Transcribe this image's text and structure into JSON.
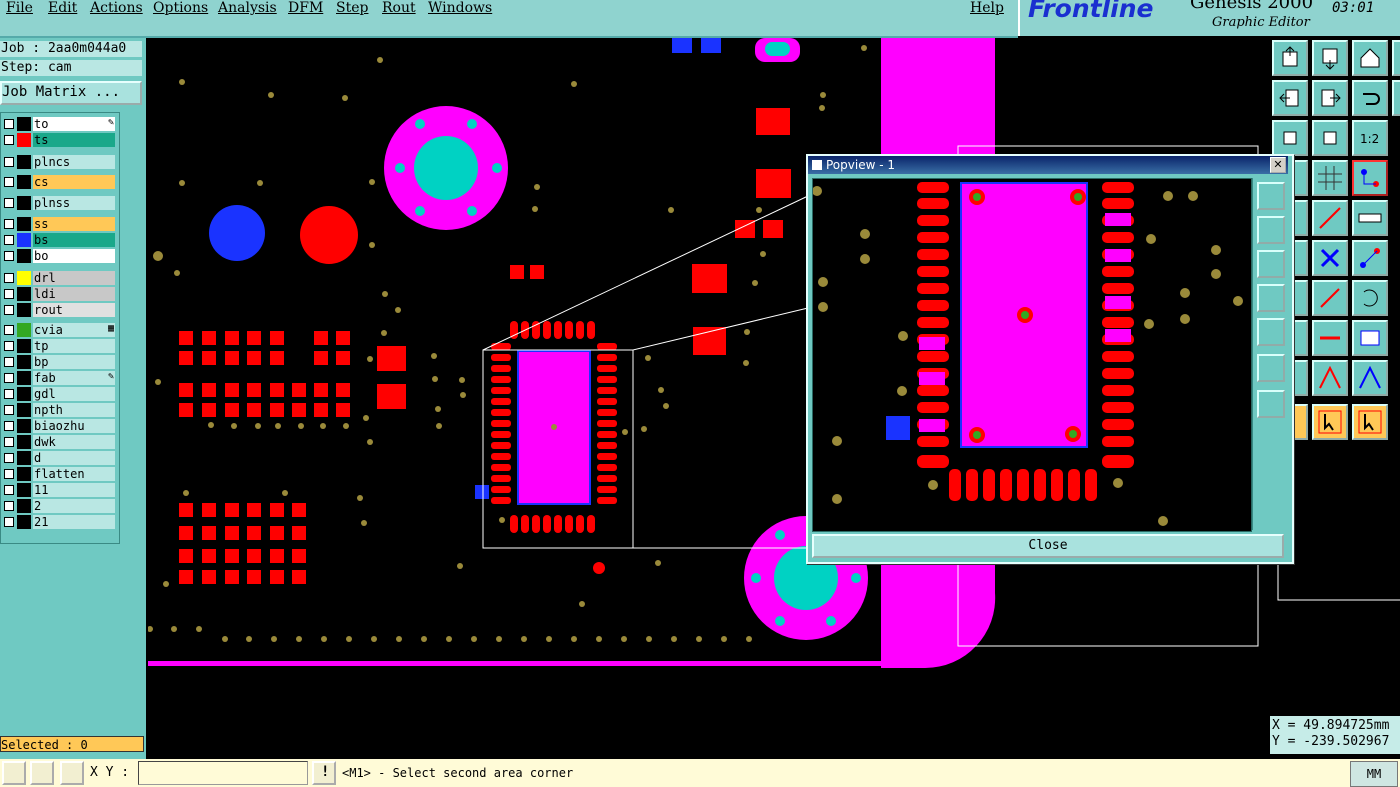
{
  "menu": {
    "file": "File",
    "edit": "Edit",
    "actions": "Actions",
    "options": "Options",
    "analysis": "Analysis",
    "dfm": "DFM",
    "step": "Step",
    "rout": "Rout",
    "windows": "Windows",
    "help": "Help"
  },
  "brand": {
    "logo": "Frontline",
    "title": "Genesis 2000",
    "subtitle": "Graphic Editor",
    "time": "03:01"
  },
  "job": {
    "job_label": "Job : 2aa0m044a0",
    "step_label": "Step: cam",
    "matrix_button": "Job Matrix ..."
  },
  "layers": [
    {
      "name": "to",
      "color": "#000000",
      "bg": "#ffffff",
      "mark": "✎"
    },
    {
      "name": "ts",
      "color": "#ff0000",
      "bg": "#1aa88a",
      "mark": ""
    },
    {
      "name": "plncs",
      "color": "#000000",
      "bg": "#b9e7e3",
      "mark": ""
    },
    {
      "name": "cs",
      "color": "#000000",
      "bg": "#ffc857",
      "mark": ""
    },
    {
      "name": "plnss",
      "color": "#000000",
      "bg": "#b9e7e3",
      "mark": ""
    },
    {
      "name": "ss",
      "color": "#000000",
      "bg": "#ffc857",
      "mark": ""
    },
    {
      "name": "bs",
      "color": "#1a33ff",
      "bg": "#1aa88a",
      "mark": ""
    },
    {
      "name": "bo",
      "color": "#000000",
      "bg": "#ffffff",
      "mark": ""
    },
    {
      "name": "drl",
      "color": "#ffff00",
      "bg": "#c8c8c8",
      "mark": ""
    },
    {
      "name": "ldi",
      "color": "#000000",
      "bg": "#c8c8c8",
      "mark": ""
    },
    {
      "name": "rout",
      "color": "#000000",
      "bg": "#e0e0e0",
      "mark": ""
    },
    {
      "name": "cvia",
      "color": "#33a822",
      "bg": "#b9e7e3",
      "mark": "▦"
    },
    {
      "name": "tp",
      "color": "#000000",
      "bg": "#b9e7e3",
      "mark": ""
    },
    {
      "name": "bp",
      "color": "#000000",
      "bg": "#b9e7e3",
      "mark": ""
    },
    {
      "name": "fab",
      "color": "#000000",
      "bg": "#b9e7e3",
      "mark": "✎"
    },
    {
      "name": "gdl",
      "color": "#000000",
      "bg": "#b9e7e3",
      "mark": ""
    },
    {
      "name": "npth",
      "color": "#000000",
      "bg": "#b9e7e3",
      "mark": ""
    },
    {
      "name": "biaozhu",
      "color": "#000000",
      "bg": "#b9e7e3",
      "mark": ""
    },
    {
      "name": "dwk",
      "color": "#000000",
      "bg": "#b9e7e3",
      "mark": ""
    },
    {
      "name": "d",
      "color": "#000000",
      "bg": "#b9e7e3",
      "mark": ""
    },
    {
      "name": "flatten",
      "color": "#000000",
      "bg": "#b9e7e3",
      "mark": ""
    },
    {
      "name": "11",
      "color": "#000000",
      "bg": "#b9e7e3",
      "mark": ""
    },
    {
      "name": "2",
      "color": "#000000",
      "bg": "#b9e7e3",
      "mark": ""
    },
    {
      "name": "21",
      "color": "#000000",
      "bg": "#b9e7e3",
      "mark": ""
    }
  ],
  "selected": "Selected : 0",
  "popview": {
    "title": "Popview - 1",
    "close_label": "Close",
    "close_x": "✕"
  },
  "coords": {
    "x": "X = 49.894725mm",
    "y": "Y = -239.502967"
  },
  "status": {
    "xy_label": "X Y :",
    "xy_value": "",
    "message": "<M1> - Select second area corner",
    "units": "MM"
  },
  "colors": {
    "panel": "#6fc9c2",
    "copper": "#ff0000",
    "mask": "#ff00ff",
    "via": "#00d2c3",
    "accent": "#1a2fd0"
  }
}
